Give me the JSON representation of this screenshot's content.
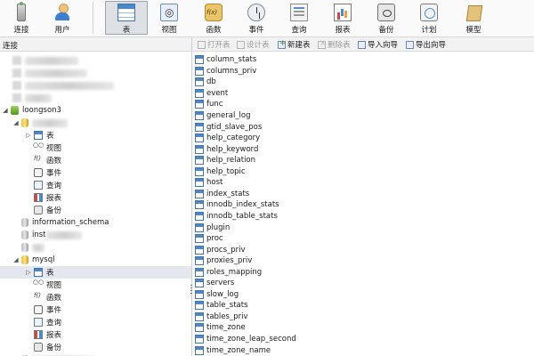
{
  "toolbar": {
    "items": [
      {
        "label": "连接",
        "icon": "connection-icon"
      },
      {
        "label": "用户",
        "icon": "user-icon"
      },
      {
        "label": "表",
        "icon": "table-icon",
        "active": true
      },
      {
        "label": "视图",
        "icon": "view-icon"
      },
      {
        "label": "函数",
        "icon": "function-icon"
      },
      {
        "label": "事件",
        "icon": "event-clock-icon"
      },
      {
        "label": "查询",
        "icon": "query-icon"
      },
      {
        "label": "报表",
        "icon": "report-icon"
      },
      {
        "label": "备份",
        "icon": "backup-icon"
      },
      {
        "label": "计划",
        "icon": "schedule-icon"
      },
      {
        "label": "模型",
        "icon": "model-icon"
      }
    ]
  },
  "left_panel": {
    "title": "连接"
  },
  "object_toolbar": {
    "open": "打开表",
    "design": "设计表",
    "new": "新建表",
    "delete": "删除表",
    "import": "导入向导",
    "export": "导出向导"
  },
  "tree": {
    "connection": "loongson3",
    "db1_children": [
      "表",
      "视图",
      "函数",
      "事件",
      "查询",
      "报表",
      "备份"
    ],
    "information_schema": "information_schema",
    "inst_prefix": "inst",
    "mysql": "mysql",
    "mysql_children": [
      "表",
      "视图",
      "函数",
      "事件",
      "查询",
      "报表",
      "备份"
    ]
  },
  "tables": [
    "column_stats",
    "columns_priv",
    "db",
    "event",
    "func",
    "general_log",
    "gtid_slave_pos",
    "help_category",
    "help_keyword",
    "help_relation",
    "help_topic",
    "host",
    "index_stats",
    "innodb_index_stats",
    "innodb_table_stats",
    "plugin",
    "proc",
    "procs_priv",
    "proxies_priv",
    "roles_mapping",
    "servers",
    "slow_log",
    "table_stats",
    "tables_priv",
    "time_zone",
    "time_zone_leap_second",
    "time_zone_name"
  ],
  "colors": {
    "selected_bg": "#e4e8ee",
    "active_tab_bg": "#dde1e6",
    "accent": "#3f74b5"
  }
}
